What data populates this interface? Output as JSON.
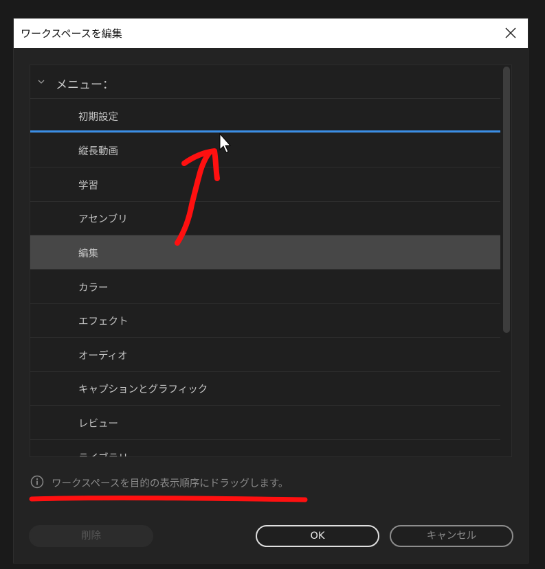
{
  "dialog": {
    "title": "ワークスペースを編集",
    "group_label": "メニュー：",
    "items": [
      {
        "label": "初期設定"
      },
      {
        "label": "縦長動画"
      },
      {
        "label": "学習"
      },
      {
        "label": "アセンブリ"
      },
      {
        "label": "編集",
        "selected": true
      },
      {
        "label": "カラー"
      },
      {
        "label": "エフェクト"
      },
      {
        "label": "オーディオ"
      },
      {
        "label": "キャプションとグラフィック"
      },
      {
        "label": "レビュー"
      },
      {
        "label": "ライブラリ"
      }
    ],
    "hint": "ワークスペースを目的の表示順序にドラッグします。",
    "buttons": {
      "delete": "削除",
      "ok": "OK",
      "cancel": "キャンセル"
    }
  },
  "icons": {
    "close": "close-icon",
    "chevron": "chevron-down-icon",
    "info": "info-icon",
    "cursor": "mouse-cursor-icon"
  },
  "colors": {
    "drop_indicator": "#3a8ee6",
    "selected_row": "#474747",
    "annotation": "#ff0000"
  }
}
